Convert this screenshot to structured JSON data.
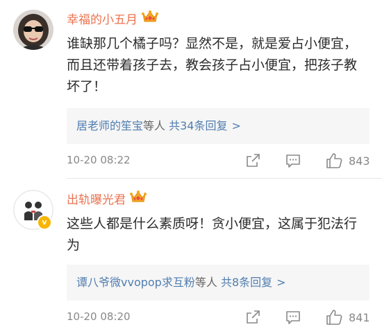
{
  "comments": [
    {
      "username": "幸福的小五月",
      "text": "谁缺那几个橘子吗？显然不是，就是爱占小便宜，而且还带着孩子去，教会孩子占小便宜，把孩子教坏了！",
      "reply_users": "居老师的笙宝",
      "reply_mid": "等人",
      "reply_count": "共34条回复",
      "reply_chevron": ">",
      "timestamp": "10-20 08:22",
      "likes": "843",
      "verified": false
    },
    {
      "username": "出轨曝光君",
      "text": "这些人都是什么素质呀！贪小便宜，这属于犯法行为",
      "reply_users": "谭八爷微vvopop求互粉",
      "reply_mid": "等人",
      "reply_count": "共8条回复",
      "reply_chevron": ">",
      "timestamp": "10-20 08:20",
      "likes": "841",
      "verified": true,
      "badge_letter": "v"
    }
  ],
  "colors": {
    "username": "#eb7350",
    "link": "#507daf",
    "meta": "#888888",
    "reply_bg": "#f6f6f6",
    "crown": "#f5a623",
    "badge": "#f7b500"
  },
  "icons": {
    "crown": "crown-icon",
    "share": "share-icon",
    "comment": "comment-icon",
    "like": "thumbs-up-icon",
    "badge": "verified-badge-icon"
  }
}
